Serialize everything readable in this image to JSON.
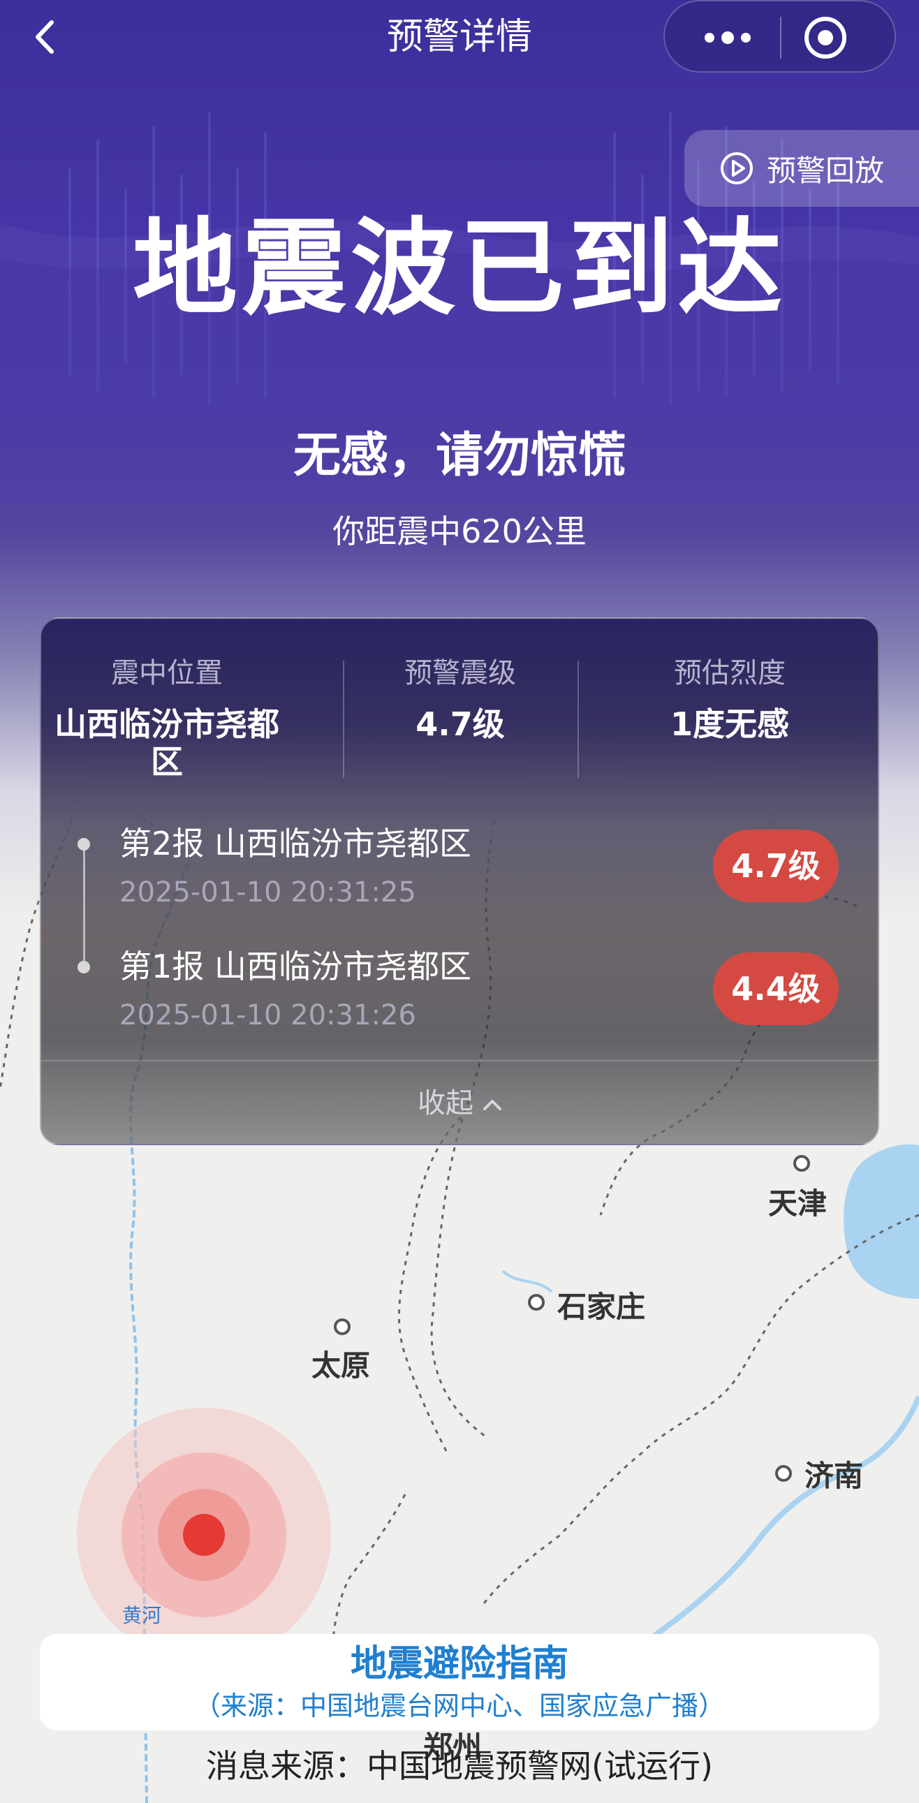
{
  "header": {
    "title": "预警详情"
  },
  "replay_button": {
    "label": "预警回放"
  },
  "headline": "地震波已到达",
  "subheadline": "无感，请勿惊慌",
  "distance_text": "你距震中620公里",
  "stats": [
    {
      "label": "震中位置",
      "value": "山西临汾市尧都区"
    },
    {
      "label": "预警震级",
      "value": "4.7级"
    },
    {
      "label": "预估烈度",
      "value": "1度无感"
    }
  ],
  "reports": [
    {
      "title": "第2报 山西临汾市尧都区",
      "time": "2025-01-10 20:31:25",
      "magnitude": "4.7级"
    },
    {
      "title": "第1报 山西临汾市尧都区",
      "time": "2025-01-10 20:31:26",
      "magnitude": "4.4级"
    }
  ],
  "collapse_label": "收起",
  "map": {
    "cities": [
      "天津",
      "石家庄",
      "太原",
      "济南",
      "郑州"
    ],
    "rivers": [
      "黄河",
      "黄河"
    ]
  },
  "guide": {
    "title": "地震避险指南",
    "source": "（来源：中国地震台网中心、国家应急广播）"
  },
  "footer_source": "消息来源：中国地震预警网(试运行)",
  "colors": {
    "header_purple": "#4233a3",
    "magnitude_badge": "#d44a42",
    "epicenter": "#e53935",
    "guide_text": "#1f7fd0"
  }
}
